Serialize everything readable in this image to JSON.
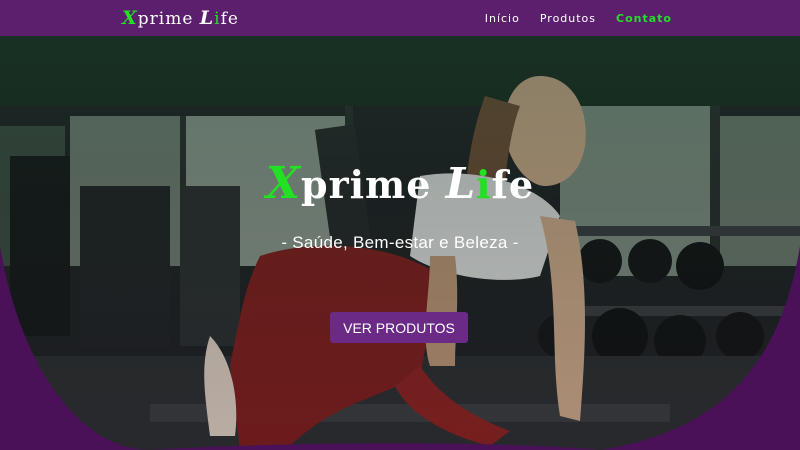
{
  "brand": {
    "x": "X",
    "rest": "prime ",
    "l": "L",
    "i": "i",
    "fe": "fe"
  },
  "nav": {
    "items": [
      {
        "label": "Início",
        "active": false
      },
      {
        "label": "Produtos",
        "active": false
      },
      {
        "label": "Contato",
        "active": true
      }
    ]
  },
  "hero": {
    "title": {
      "x": "X",
      "rest": "prime ",
      "l": "L",
      "i": "i",
      "fe": "fe"
    },
    "subtitle": "- Saúde, Bem-estar e Beleza -",
    "cta_label": "VER PRODUTOS"
  },
  "colors": {
    "nav_bg": "#5c1f6e",
    "accent_green": "#22e022",
    "curve_purple": "#4a1158",
    "button_bg": "#6a2a86"
  }
}
